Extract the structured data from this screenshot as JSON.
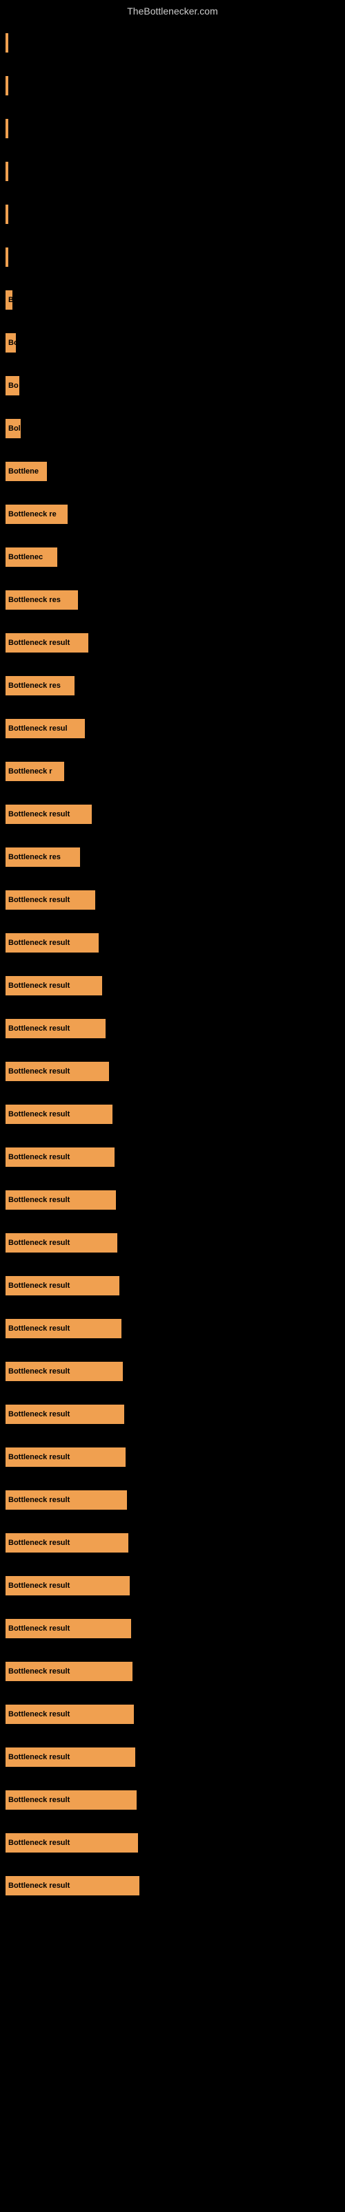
{
  "site_title": "TheBottlenecker.com",
  "bars": [
    {
      "label": "",
      "width": 2
    },
    {
      "label": "",
      "width": 2
    },
    {
      "label": "",
      "width": 3
    },
    {
      "label": "",
      "width": 2
    },
    {
      "label": "",
      "width": 2
    },
    {
      "label": "",
      "width": 3
    },
    {
      "label": "B",
      "width": 10
    },
    {
      "label": "Bo",
      "width": 15
    },
    {
      "label": "Bo",
      "width": 20
    },
    {
      "label": "Bol",
      "width": 22
    },
    {
      "label": "Bottlene",
      "width": 60
    },
    {
      "label": "Bottleneck re",
      "width": 90
    },
    {
      "label": "Bottlenec",
      "width": 75
    },
    {
      "label": "Bottleneck res",
      "width": 105
    },
    {
      "label": "Bottleneck result",
      "width": 120
    },
    {
      "label": "Bottleneck res",
      "width": 100
    },
    {
      "label": "Bottleneck resul",
      "width": 115
    },
    {
      "label": "Bottleneck r",
      "width": 85
    },
    {
      "label": "Bottleneck result",
      "width": 125
    },
    {
      "label": "Bottleneck res",
      "width": 108
    },
    {
      "label": "Bottleneck result",
      "width": 130
    },
    {
      "label": "Bottleneck result",
      "width": 135
    },
    {
      "label": "Bottleneck result",
      "width": 140
    },
    {
      "label": "Bottleneck result",
      "width": 145
    },
    {
      "label": "Bottleneck result",
      "width": 150
    },
    {
      "label": "Bottleneck result",
      "width": 155
    },
    {
      "label": "Bottleneck result",
      "width": 158
    },
    {
      "label": "Bottleneck result",
      "width": 160
    },
    {
      "label": "Bottleneck result",
      "width": 162
    },
    {
      "label": "Bottleneck result",
      "width": 165
    },
    {
      "label": "Bottleneck result",
      "width": 168
    },
    {
      "label": "Bottleneck result",
      "width": 170
    },
    {
      "label": "Bottleneck result",
      "width": 172
    },
    {
      "label": "Bottleneck result",
      "width": 174
    },
    {
      "label": "Bottleneck result",
      "width": 176
    },
    {
      "label": "Bottleneck result",
      "width": 178
    },
    {
      "label": "Bottleneck result",
      "width": 180
    },
    {
      "label": "Bottleneck result",
      "width": 182
    },
    {
      "label": "Bottleneck result",
      "width": 184
    },
    {
      "label": "Bottleneck result",
      "width": 186
    },
    {
      "label": "Bottleneck result",
      "width": 188
    },
    {
      "label": "Bottleneck result",
      "width": 190
    },
    {
      "label": "Bottleneck result",
      "width": 192
    },
    {
      "label": "Bottleneck result",
      "width": 194
    }
  ]
}
